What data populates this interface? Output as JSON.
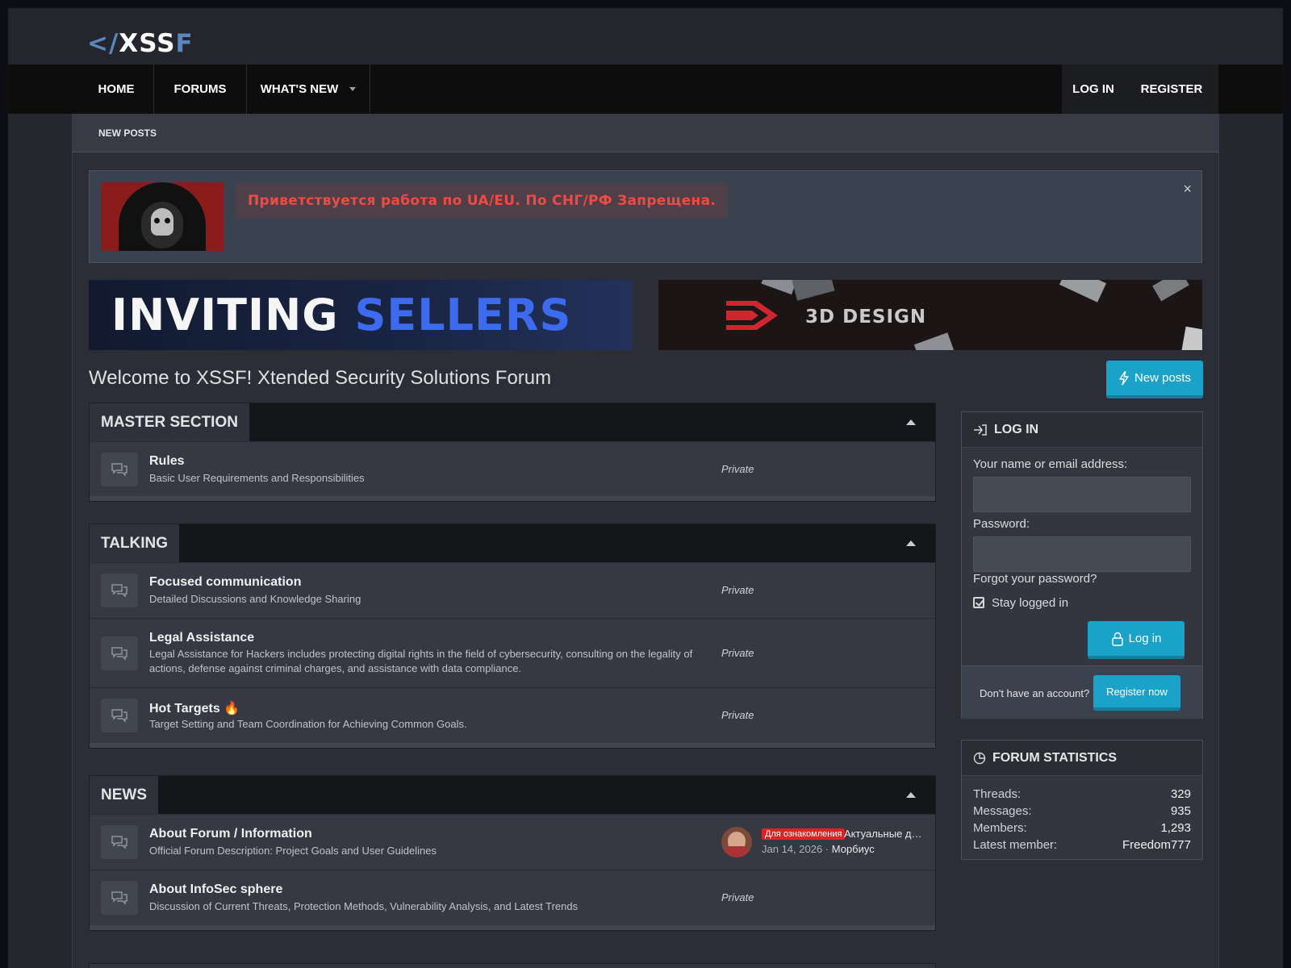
{
  "header": {
    "logo": {
      "lt": "</",
      "mid": "XSS",
      "end": "F"
    }
  },
  "nav": {
    "tabs": [
      "HOME",
      "FORUMS",
      "WHAT'S NEW"
    ],
    "login": "LOG IN",
    "register": "REGISTER",
    "subnav": "NEW POSTS"
  },
  "notice": {
    "message": "Приветствуется работа по UA/EU. По СНГ/РФ Запрещена.",
    "close": "×"
  },
  "banners": {
    "left": {
      "word1": "INVITING",
      "word2": "SELLERS"
    },
    "right": {
      "text": "3D DESIGN"
    }
  },
  "main": {
    "welcome": "Welcome to XSSF! Xtended Security Solutions Forum",
    "new_posts_button": "New posts"
  },
  "sections": [
    {
      "title": "MASTER SECTION",
      "nodes": [
        {
          "title": "Rules",
          "desc": "Basic User Requirements and Responsibilities",
          "stat": "Private"
        }
      ]
    },
    {
      "title": "TALKING",
      "nodes": [
        {
          "title": "Focused communication",
          "desc": "Detailed Discussions and Knowledge Sharing",
          "stat": "Private"
        },
        {
          "title": "Legal Assistance",
          "desc": "Legal Assistance for Hackers includes protecting digital rights in the field of cybersecurity, consulting on the legality of actions, defense against criminal charges, and assistance with data compliance.",
          "stat": "Private"
        },
        {
          "title": "Hot Targets 🔥",
          "desc": "Target Setting and Team Coordination for Achieving Common Goals.",
          "stat": "Private"
        }
      ]
    },
    {
      "title": "NEWS",
      "nodes": [
        {
          "title": "About Forum / Information",
          "desc": "Official Forum Description: Project Goals and User Guidelines",
          "last": {
            "prefix": "Для ознакомления",
            "title": "Актуальные домены форума",
            "date": "Jan 14, 2026",
            "user": "Морбиус"
          }
        },
        {
          "title": "About InfoSec sphere",
          "desc": "Discussion of Current Threats, Protection Methods, Vulnerability Analysis, and Latest Trends",
          "stat": "Private"
        }
      ]
    }
  ],
  "login_box": {
    "title": "LOG IN",
    "name_label": "Your name or email address:",
    "password_label": "Password:",
    "forgot": "Forgot your password?",
    "stay": "Stay logged in",
    "login_button": "Log in",
    "no_account": "Don't have an account?",
    "register_button": "Register now"
  },
  "stats_box": {
    "title": "FORUM STATISTICS",
    "rows": [
      {
        "label": "Threads:",
        "value": "329"
      },
      {
        "label": "Messages:",
        "value": "935"
      },
      {
        "label": "Members:",
        "value": "1,293"
      },
      {
        "label": "Latest member:",
        "value": "Freedom777"
      }
    ]
  },
  "colors": {
    "accent": "#1aa2c9",
    "logo_blue": "#5b86bd",
    "notice_red": "#f04a42"
  }
}
